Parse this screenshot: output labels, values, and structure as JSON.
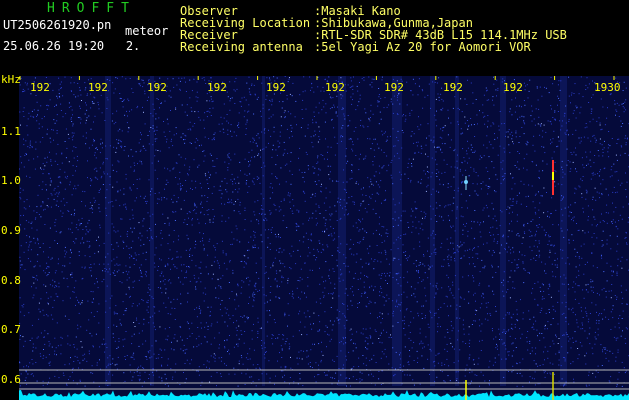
{
  "header": {
    "app_title": "HROFFT",
    "file_name": "UT2506261920.pn",
    "tag": "meteor",
    "date_time": "25.06.26 19:20   2.",
    "meta_labels": "Observer\nReceiving Location\nReceiver\nReceiving antenna",
    "meta_values": ":Masaki Kano\n:Shibukawa,Gunma,Japan\n:RTL-SDR SDR# 43dB L15 114.1MHz USB\n:5el Yagi Az 20 for Aomori VOR"
  },
  "axes": {
    "y_unit": "kHz",
    "y_ticks": [
      "1.1",
      "1.0",
      "0.9",
      "0.8",
      "0.7",
      "0.6"
    ],
    "x_ticks": [
      "192",
      "192",
      "192",
      "192",
      "192",
      "192",
      "192",
      "192",
      "192",
      "1930"
    ]
  },
  "colors": {
    "title": "#22cc22",
    "text": "#ffffff",
    "meta_text": "#ffff66",
    "axis_text": "#ffff00",
    "background": "#050a3a",
    "noise": "#3a5cff",
    "baseline": "#00e5ff",
    "meteor_streak": "#ff3030",
    "reference_line": "#d8d800"
  }
}
